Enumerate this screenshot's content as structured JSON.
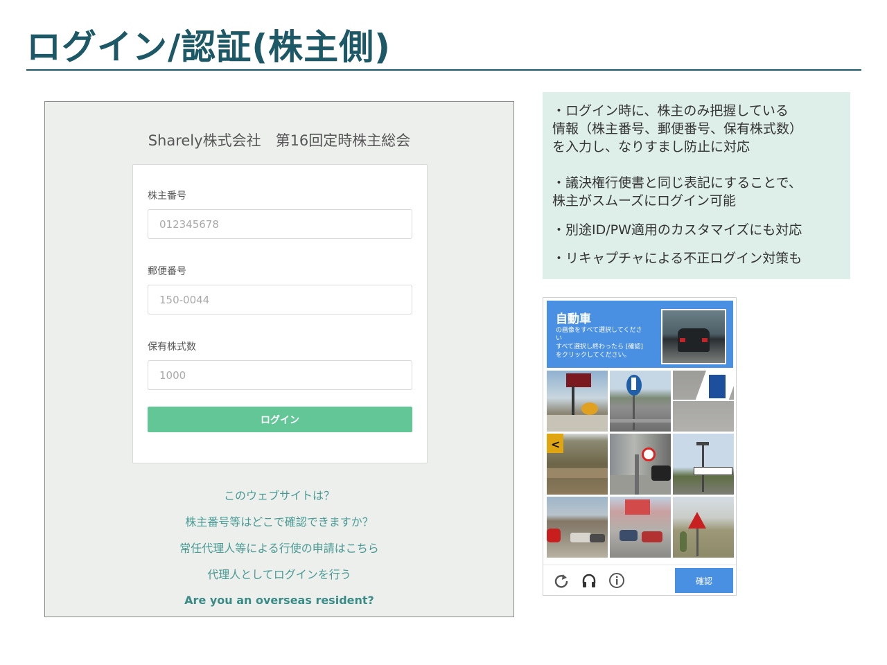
{
  "slide": {
    "title": "ログイン/認証(株主側)"
  },
  "login_screen": {
    "meeting_title": "Sharely株式会社　第16回定時株主総会",
    "fields": [
      {
        "label": "株主番号",
        "placeholder": "012345678"
      },
      {
        "label": "郵便番号",
        "placeholder": "150-0044"
      },
      {
        "label": "保有株式数",
        "placeholder": "1000"
      }
    ],
    "login_button": "ログイン",
    "links": [
      "このウェブサイトは？",
      "株主番号等はどこで確認できますか？",
      "常任代理人等による行使の申請はこちら",
      "代理人としてログインを行う",
      "Are you an overseas resident?"
    ]
  },
  "notes": {
    "item1": [
      "・ログイン時に、株主のみ把握している",
      "情報（株主番号、郵便番号、保有株式数）",
      "を入力し、なりすまし防止に対応"
    ],
    "item2": [
      "・議決権行使書と同じ表記にすることで、",
      "株主がスムーズにログイン可能"
    ],
    "item3": "・別途ID/PW適用のカスタマイズにも対応",
    "item4": "・リキャプチャによる不正ログイン対策も"
  },
  "captcha": {
    "target": "自動車",
    "instruction": [
      "の画像をすべて選択してくださ",
      "い",
      "すべて選択し終わったら [確認]",
      "をクリックしてください。"
    ],
    "verify_button": "確認",
    "colors": {
      "header": "#4a90e2",
      "button": "#4a90e2"
    },
    "tiles": [
      "shop-sign-tile",
      "arrow-sign-tile",
      "road-sign-tile",
      "curve-sign-tile",
      "street-tile",
      "street-name-sign-tile",
      "stop-sign-tile",
      "cars-tile",
      "warning-sign-tile"
    ],
    "footer_icons": [
      "reload-icon",
      "headphones-icon",
      "info-icon"
    ]
  },
  "colors": {
    "title": "#1d5866",
    "login_button": "#63c697",
    "link": "#4a9a94",
    "notes_bg": "#ddefe8"
  }
}
